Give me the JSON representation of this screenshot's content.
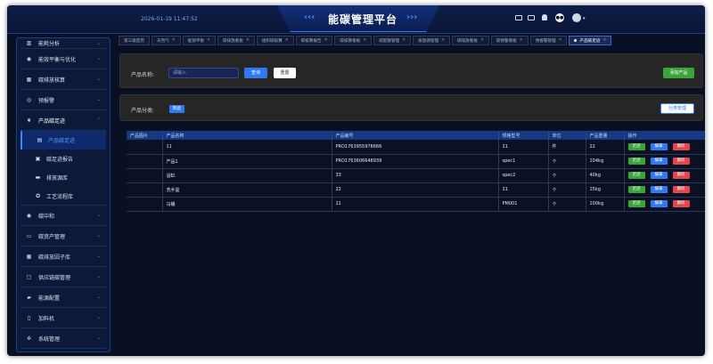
{
  "header": {
    "datetime": "2026-01-19 11:47:52",
    "title": "能碳管理平台",
    "icons": [
      "monitor-icon",
      "screen-icon",
      "bell-icon",
      "menu-circle-icon",
      "avatar"
    ]
  },
  "sidebar": {
    "items": [
      {
        "label": "能耗分析",
        "icon": "chart-icon"
      },
      {
        "label": "能效平衡与优化",
        "icon": "globe-icon"
      },
      {
        "label": "碳排放核算",
        "icon": "grid-icon"
      },
      {
        "label": "预报警",
        "icon": "alert-icon"
      },
      {
        "label": "产品碳足迹",
        "icon": "leaf-icon"
      }
    ],
    "sub_items": [
      {
        "label": "产品碳足迹",
        "icon": "list-icon",
        "active": true
      },
      {
        "label": "碳足迹报告",
        "icon": "report-icon",
        "active": false
      },
      {
        "label": "排放源库",
        "icon": "database-icon",
        "active": false
      },
      {
        "label": "工艺流程库",
        "icon": "flow-icon",
        "active": false
      }
    ],
    "items_after": [
      {
        "label": "碳中和",
        "icon": "globe-icon"
      },
      {
        "label": "碳资产管理",
        "icon": "monitor-icon"
      },
      {
        "label": "碳排放因子库",
        "icon": "table-icon"
      },
      {
        "label": "供应链碳管理",
        "icon": "chain-icon"
      },
      {
        "label": "能源配置",
        "icon": "car-icon"
      },
      {
        "label": "加料机",
        "icon": "doc-icon"
      },
      {
        "label": "系统管理",
        "icon": "gear-icon"
      }
    ]
  },
  "tabs": [
    {
      "label": "第三级首页",
      "active": false
    },
    {
      "label": "天然气",
      "active": false
    },
    {
      "label": "能源平衡",
      "active": false
    },
    {
      "label": "碳排放看板",
      "active": false
    },
    {
      "label": "组织碳核算",
      "active": false
    },
    {
      "label": "碳核算报告",
      "active": false
    },
    {
      "label": "碳核算看板",
      "active": false
    },
    {
      "label": "碳配额管理",
      "active": false
    },
    {
      "label": "排放源管理",
      "active": false
    },
    {
      "label": "碳排放看板",
      "active": false
    },
    {
      "label": "碳预警看板",
      "active": false
    },
    {
      "label": "预报警管理",
      "active": false
    },
    {
      "label": "产品碳足迹",
      "active": true
    }
  ],
  "search": {
    "label": "产品名称:",
    "placeholder": "请输入",
    "query_label": "查询",
    "reset_label": "重置",
    "add_label": "添加产品"
  },
  "category": {
    "label": "产品分类:",
    "chip": "陶瓷",
    "manage_label": "分类管理"
  },
  "table": {
    "columns": [
      "产品图片",
      "产品名称",
      "产品编号",
      "规格型号",
      "单位",
      "产品重量",
      "操作"
    ],
    "rows": [
      {
        "image": "",
        "name": "11",
        "code": "PRO1763955978666",
        "spec": "11",
        "unit": "件",
        "weight": "22"
      },
      {
        "image": "",
        "name": "产品1",
        "code": "PRO1763606648939",
        "spec": "spec1",
        "unit": "个",
        "weight": "104kg"
      },
      {
        "image": "",
        "name": "浴缸",
        "code": "33",
        "spec": "spec2",
        "unit": "个",
        "weight": "40kg"
      },
      {
        "image": "",
        "name": "洗手盆",
        "code": "22",
        "spec": "11",
        "unit": "个",
        "weight": "15kg"
      },
      {
        "image": "",
        "name": "马桶",
        "code": "11",
        "spec": "PM001",
        "unit": "个",
        "weight": "100kg"
      }
    ],
    "ops": {
      "view": "足迹",
      "edit": "编辑",
      "delete": "删除"
    }
  }
}
